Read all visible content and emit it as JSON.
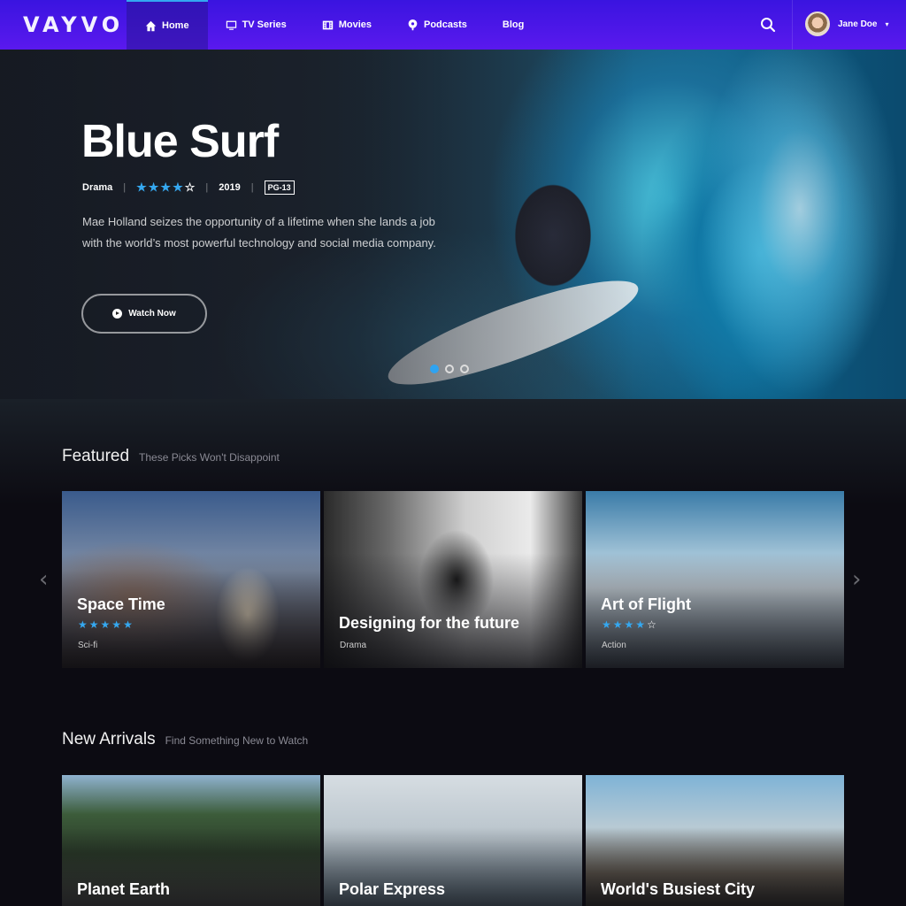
{
  "nav": {
    "logo": "VAYVO",
    "items": [
      {
        "label": "Home",
        "icon": "home-icon",
        "active": true
      },
      {
        "label": "TV Series",
        "icon": "tv-icon",
        "active": false
      },
      {
        "label": "Movies",
        "icon": "film-icon",
        "active": false
      },
      {
        "label": "Podcasts",
        "icon": "podcast-icon",
        "active": false
      },
      {
        "label": "Blog",
        "icon": "",
        "active": false
      }
    ],
    "search_icon": "search-icon",
    "user": {
      "name": "Jane Doe",
      "chevron": "▾"
    }
  },
  "hero": {
    "title": "Blue Surf",
    "genre": "Drama",
    "rating_stars": 4,
    "rating_max": 5,
    "year": "2019",
    "age_rating": "PG-13",
    "description": "Mae Holland seizes the opportunity of a lifetime when she lands a job with the world’s most powerful technology and social media company.",
    "watch_label": "Watch Now",
    "slides": 3,
    "active_slide": 1
  },
  "featured": {
    "title": "Featured",
    "subtitle": "These Picks Won't Disappoint",
    "cards": [
      {
        "title": "Space Time",
        "stars": 5,
        "genre": "Sci-fi"
      },
      {
        "title": "Designing for the future",
        "stars": 0,
        "genre": "Drama"
      },
      {
        "title": "Art of Flight",
        "stars": 4,
        "genre": "Action"
      }
    ],
    "prev_arrow": "‹",
    "next_arrow": "›"
  },
  "new_arrivals": {
    "title": "New Arrivals",
    "subtitle": "Find Something New to Watch",
    "cards": [
      {
        "title": "Planet Earth"
      },
      {
        "title": "Polar Express"
      },
      {
        "title": "World's Busiest City"
      }
    ]
  },
  "colors": {
    "nav_top": "#3a14e0",
    "nav_bottom": "#5a19ee",
    "accent": "#35a8f0",
    "background": "#0c0b12"
  }
}
